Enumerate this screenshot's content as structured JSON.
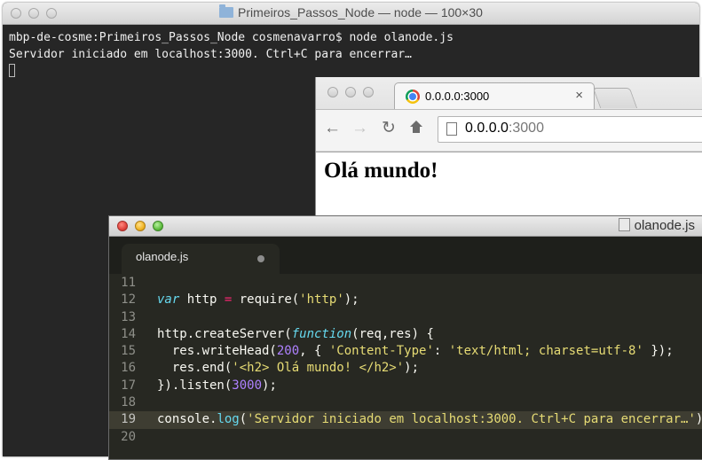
{
  "terminal": {
    "title": "Primeiros_Passos_Node — node — 100×30",
    "lines": [
      "mbp-de-cosme:Primeiros_Passos_Node cosmenavarro$ node olanode.js",
      "Servidor iniciado em localhost:3000. Ctrl+C para encerrar…"
    ]
  },
  "browser": {
    "tab_title": "0.0.0.0:3000",
    "tab_close": "×",
    "url_host": "0.0.0.0",
    "url_port": ":3000",
    "page_heading": "Olá mundo!",
    "nav": {
      "back": "←",
      "forward": "→",
      "reload": "↻"
    }
  },
  "editor": {
    "window_title": "olanode.js",
    "tab_label": "olanode.js",
    "current_line": "19",
    "line_numbers": [
      "11",
      "12",
      "13",
      "14",
      "15",
      "16",
      "17",
      "18",
      "19",
      "20"
    ],
    "code": {
      "l12": {
        "kw": "var",
        "a": " http ",
        "op": "=",
        "b": " require(",
        "str": "'http'",
        "c": ");"
      },
      "l14": {
        "a": "http.createServer(",
        "kw": "function",
        "b": "(req,res) {"
      },
      "l15": {
        "a": "  res.writeHead(",
        "num": "200",
        "b": ", { ",
        "s1": "'Content-Type'",
        "c": ": ",
        "s2": "'text/html; charset=utf-8'",
        "d": " });"
      },
      "l16": {
        "a": "  res.end(",
        "str": "'<h2> Olá mundo! </h2>'",
        "b": ");"
      },
      "l17": {
        "a": "}).listen(",
        "num": "3000",
        "b": ");"
      },
      "l19": {
        "a": "console.",
        "fn": "log",
        "b": "(",
        "str": "'Servidor iniciado em localhost:3000. Ctrl+C para encerrar…'",
        "c": ");"
      }
    }
  },
  "colors": {
    "terminal_bg": "#262626",
    "editor_bg": "#272822",
    "keyword": "#66d9ef",
    "string": "#e6db74",
    "number": "#ae81ff",
    "operator": "#f92672"
  }
}
